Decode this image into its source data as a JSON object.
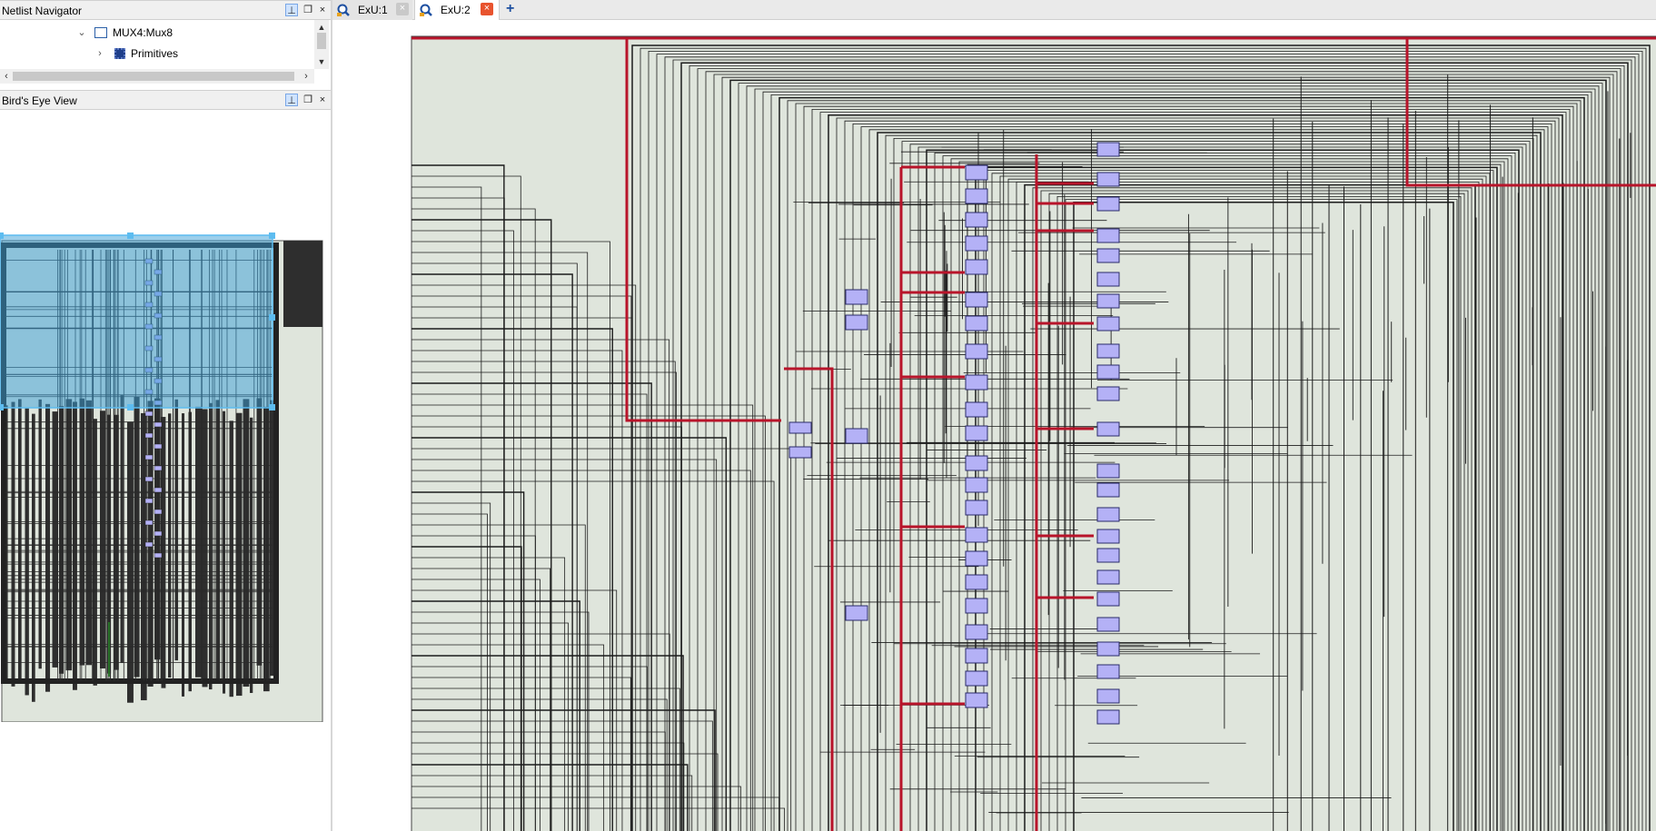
{
  "netlist_navigator": {
    "title": "Netlist Navigator",
    "tree": [
      {
        "label": "MUX4:Mux8",
        "expanded": true,
        "icon": "module-icon"
      },
      {
        "label": "Primitives",
        "expanded": false,
        "icon": "chip-icon"
      }
    ]
  },
  "birds_eye": {
    "title": "Bird's Eye View"
  },
  "tabs": [
    {
      "label": "ExU:1",
      "active": false
    },
    {
      "label": "ExU:2",
      "active": true
    }
  ],
  "colors": {
    "canvas_bg": "#dfe5dc",
    "wire": "#1c1c1c",
    "wire_highlight": "#b8142a",
    "cell_fill": "#b4b1f6",
    "cell_border": "#2a2a6a",
    "selection": "#3aa0d8"
  }
}
